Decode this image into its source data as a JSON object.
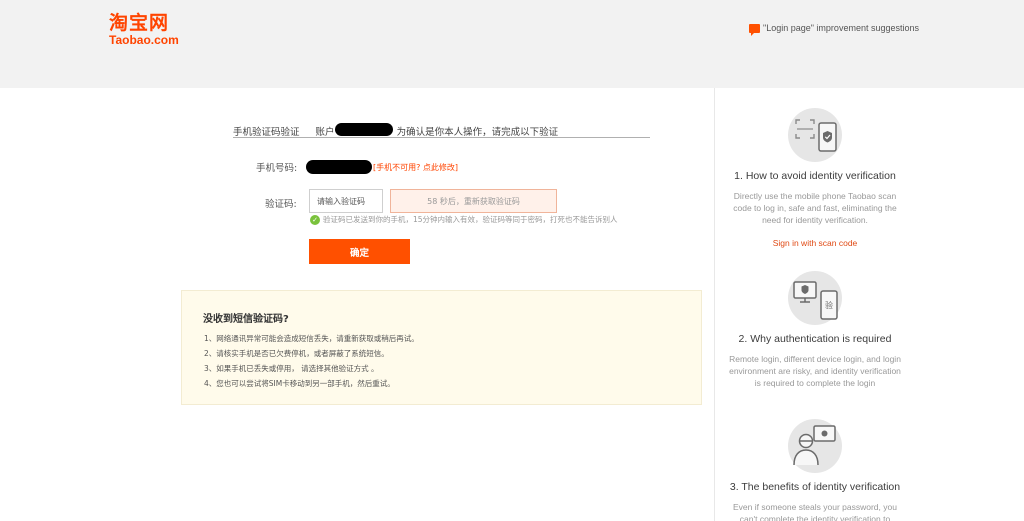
{
  "header": {
    "logo_cn": "淘宝网",
    "logo_en": "Taobao.com",
    "feedback_label": "\"Login page\" improvement suggestions",
    "feedback_icon": "chat-bubble-icon"
  },
  "verify": {
    "title_method": "手机验证码验证",
    "title_account_prefix": "账户",
    "title_suffix": "为确认是你本人操作，请完成以下验证",
    "phone_label": "手机号码:",
    "phone_unavailable": "[手机不可用? 点此修改]",
    "code_label": "验证码:",
    "code_placeholder": "请输入验证码",
    "code_value": "",
    "resend_label": "58 秒后，重新获取验证码",
    "sent_tip": "验证码已发送到你的手机，15分钟内输入有效，验证码等同于密码，打死也不能告诉别人",
    "confirm_label": "确定"
  },
  "help": {
    "heading": "没收到短信验证码?",
    "items": [
      "1、网络通讯异常可能会造成短信丢失，请重新获取或稍后再试。",
      "2、请核实手机是否已欠费停机，或者屏蔽了系统短信。",
      "3、如果手机已丢失或停用， 请选择其他验证方式 。",
      "4、您也可以尝试将SIM卡移动到另一部手机，然后重试。"
    ]
  },
  "sidebar": {
    "sections": [
      {
        "icon": "scan-phone-icon",
        "title": "1. How to avoid identity verification",
        "desc": "Directly use the mobile phone Taobao scan code to log in, safe and fast, eliminating the need for identity verification.",
        "link": "Sign in with scan code"
      },
      {
        "icon": "device-verify-icon",
        "title": "2. Why authentication is required",
        "desc": "Remote login, different device login, and login environment are risky, and identity verification is required to complete the login"
      },
      {
        "icon": "user-monitor-icon",
        "title": "3. The benefits of identity verification",
        "desc": "Even if someone steals your password, you can't complete the identity verification to"
      }
    ]
  },
  "colors": {
    "brand": "#ff4400",
    "button": "#ff5000",
    "link": "#e04a14",
    "success": "#7ac23c",
    "help_bg": "#fffbeb"
  }
}
